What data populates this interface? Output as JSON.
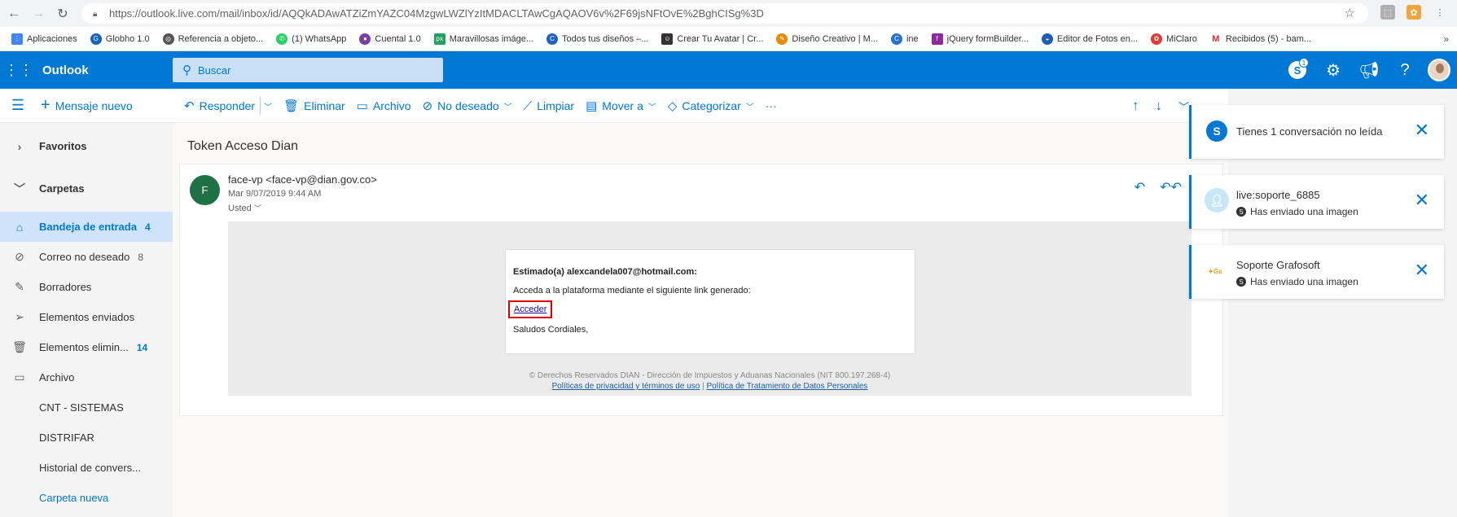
{
  "browser": {
    "url": "https://outlook.live.com/mail/inbox/id/AQQkADAwATZiZmYAZC04MzgwLWZlYzItMDACLTAwCgAQAOV6v%2F69jsNFtOvE%2BghCISg%3D",
    "bookmarks": [
      {
        "label": "Aplicaciones",
        "color": "#4285f4",
        "icon": "apps-grid-icon"
      },
      {
        "label": "Globho 1.0",
        "color": "#1565c0",
        "icon": "globho-icon"
      },
      {
        "label": "Referencia a objeto...",
        "color": "#555555",
        "icon": "globe-icon"
      },
      {
        "label": "(1) WhatsApp",
        "color": "#25d366",
        "icon": "whatsapp-icon"
      },
      {
        "label": "Cuental 1.0",
        "color": "#7b3fa0",
        "icon": "cuental-icon"
      },
      {
        "label": "Maravillosas imáge...",
        "color": "#1fa35d",
        "icon": "px-icon"
      },
      {
        "label": "Todos tus diseños –...",
        "color": "#1e63c4",
        "icon": "canva-icon"
      },
      {
        "label": "Crear Tu Avatar | Cr...",
        "color": "#333333",
        "icon": "avatar-bookmark-icon"
      },
      {
        "label": "Diseño Creativo | M...",
        "color": "#e68a00",
        "icon": "diseno-icon"
      },
      {
        "label": "ine",
        "color": "#2a6fd6",
        "icon": "ine-icon"
      },
      {
        "label": "jQuery formBuilder...",
        "color": "#8e2a9e",
        "icon": "formbuilder-icon"
      },
      {
        "label": "Editor de Fotos en...",
        "color": "#1d5fb8",
        "icon": "photo-editor-icon"
      },
      {
        "label": "MiClaro",
        "color": "#e53935",
        "icon": "miclaro-icon"
      },
      {
        "label": "Recibidos (5) - bam...",
        "color": "#d93025",
        "icon": "gmail-icon"
      }
    ],
    "more": "»"
  },
  "suite": {
    "brand": "Outlook",
    "search_placeholder": "Buscar",
    "skype_badge": "1"
  },
  "commands": {
    "new_message": "Mensaje nuevo",
    "reply": "Responder",
    "delete": "Eliminar",
    "archive": "Archivo",
    "junk": "No deseado",
    "sweep": "Limpiar",
    "move": "Mover a",
    "categorize": "Categorizar",
    "more": "···"
  },
  "sidebar": {
    "favorites": "Favoritos",
    "folders": "Carpetas",
    "items": [
      {
        "label": "Bandeja de entrada",
        "count": "4"
      },
      {
        "label": "Correo no deseado",
        "count": "8"
      },
      {
        "label": "Borradores",
        "count": ""
      },
      {
        "label": "Elementos enviados",
        "count": ""
      },
      {
        "label": "Elementos elimin...",
        "count": "14"
      },
      {
        "label": "Archivo",
        "count": ""
      },
      {
        "label": "CNT - SISTEMAS",
        "count": ""
      },
      {
        "label": "DISTRIFAR",
        "count": ""
      },
      {
        "label": "Historial de convers...",
        "count": ""
      },
      {
        "label": "Carpeta nueva",
        "count": ""
      }
    ]
  },
  "message": {
    "subject": "Token Acceso Dian",
    "avatar_letter": "F",
    "sender": "face-vp <face-vp@dian.gov.co>",
    "date": "Mar 9/07/2019 9:44 AM",
    "to": "Usted",
    "greeting": "Estimado(a) alexcandela007@hotmail.com:",
    "line1": "Acceda a la plataforma mediante el siguiente link generado:",
    "link": "Acceder",
    "regards": "Saludos Cordiales,",
    "footer": "© Derechos Reservados DIAN - Dirección de Impuestos y Aduanas Nacionales (NIT 800.197.268-4)",
    "privacy_link": "Políticas de privacidad y términos de uso",
    "footer_sep": "|",
    "data_link": "Política de Tratamiento de Datos Personales"
  },
  "notifications": [
    {
      "title": "Tienes 1 conversación no leída",
      "sub": "",
      "icon": "skype-icon",
      "color": "#0078d4"
    },
    {
      "title": "live:soporte_6885",
      "sub": "Has enviado una imagen",
      "icon": "user-avatar-icon",
      "color": "#c7e7f7"
    },
    {
      "title": "Soporte Grafosoft",
      "sub": "Has enviado una imagen",
      "icon": "grafosoft-logo-icon",
      "color": "#ffffff"
    }
  ]
}
